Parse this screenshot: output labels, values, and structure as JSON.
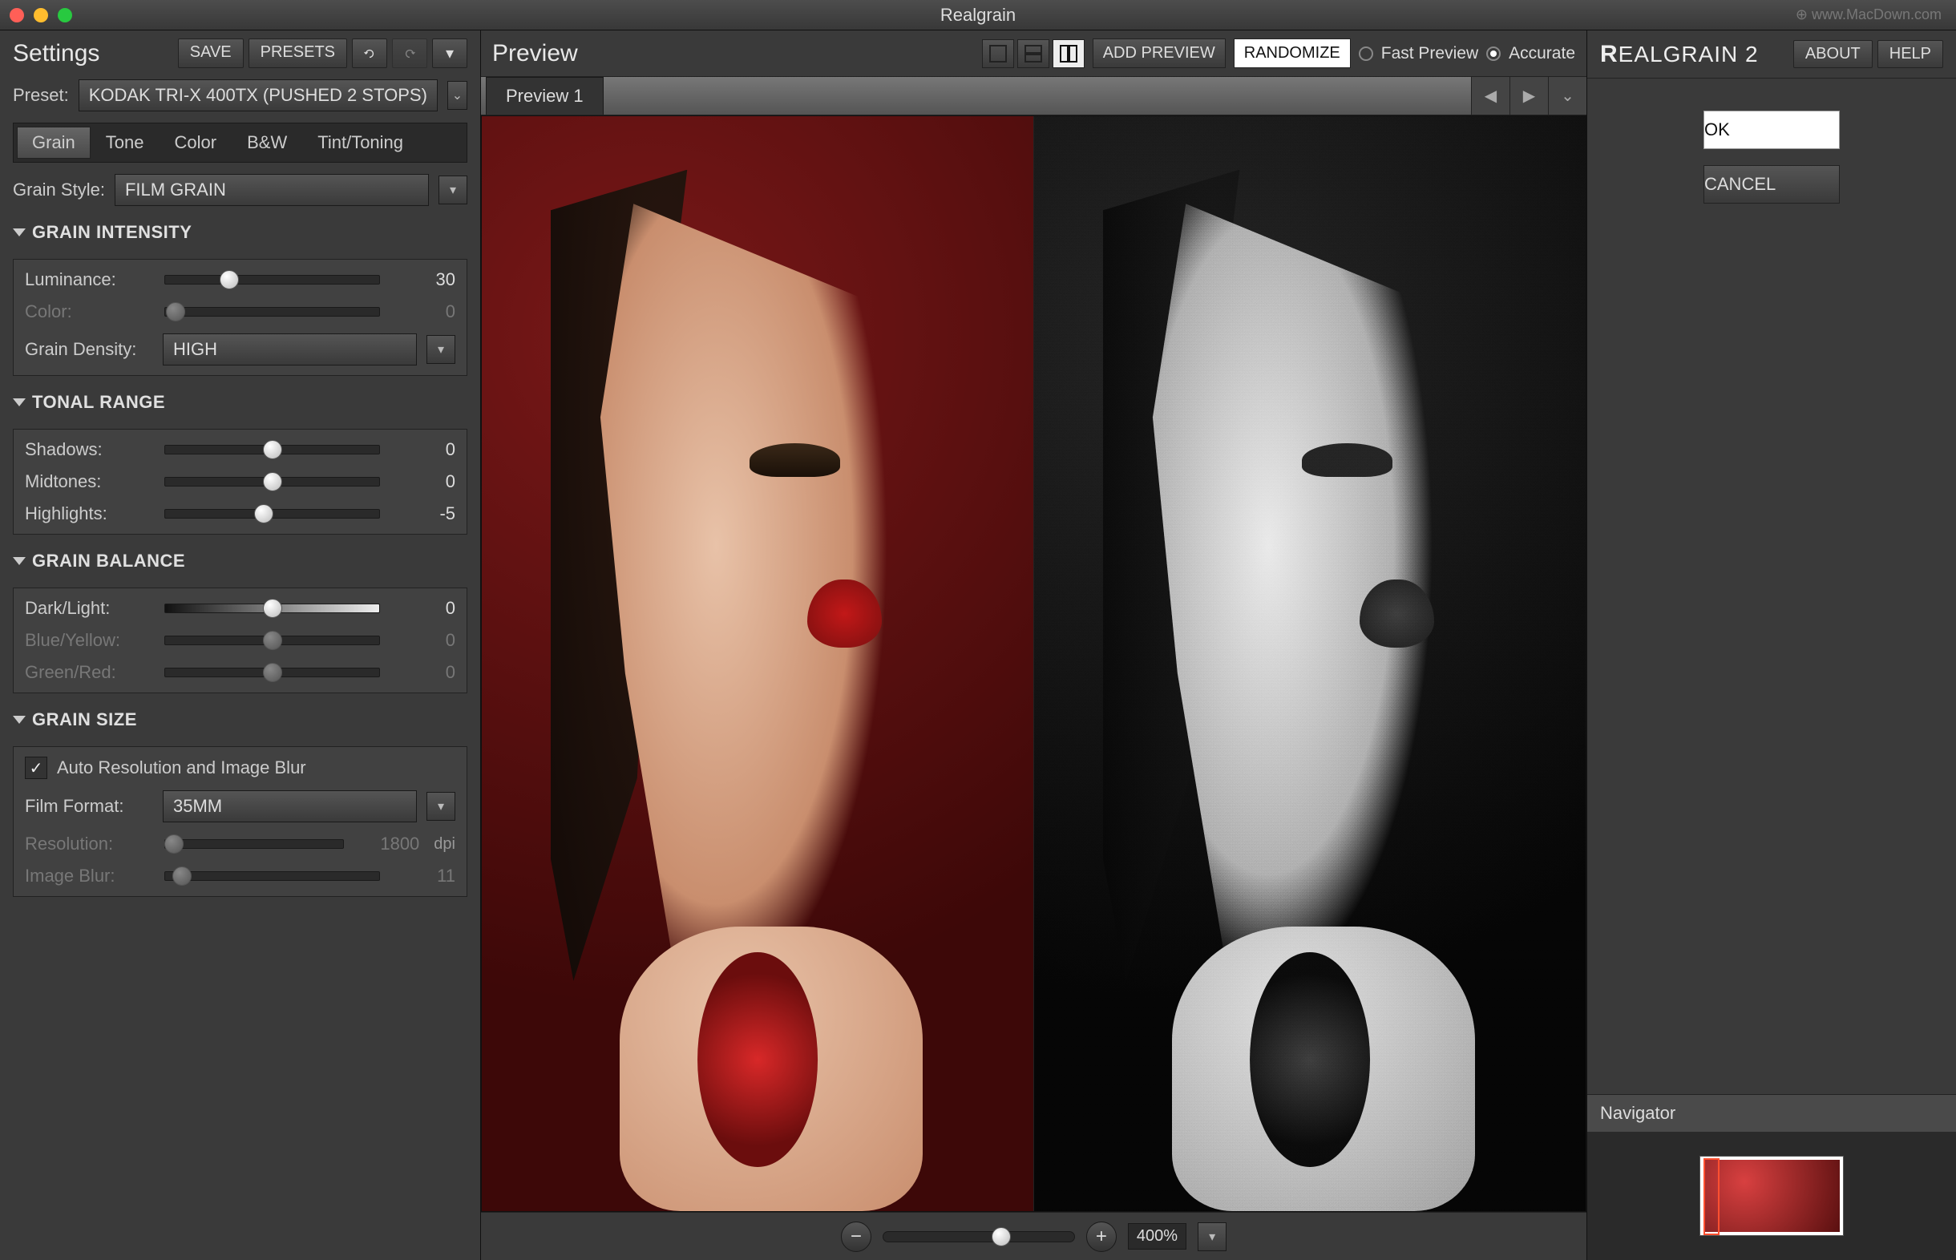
{
  "window": {
    "title": "Realgrain",
    "watermark": "⊕ www.MacDown.com"
  },
  "left": {
    "title": "Settings",
    "save": "SAVE",
    "presets": "PRESETS",
    "preset_label": "Preset:",
    "preset_value": "KODAK TRI-X 400TX (PUSHED 2 STOPS)",
    "tabs": [
      "Grain",
      "Tone",
      "Color",
      "B&W",
      "Tint/Toning"
    ],
    "grain_style_label": "Grain Style:",
    "grain_style_value": "FILM GRAIN",
    "sec_intensity": "GRAIN INTENSITY",
    "luminance_label": "Luminance:",
    "luminance_val": "30",
    "color_label": "Color:",
    "color_val": "0",
    "density_label": "Grain Density:",
    "density_value": "HIGH",
    "sec_tonal": "TONAL RANGE",
    "shadows_label": "Shadows:",
    "shadows_val": "0",
    "midtones_label": "Midtones:",
    "midtones_val": "0",
    "highlights_label": "Highlights:",
    "highlights_val": "-5",
    "sec_balance": "GRAIN BALANCE",
    "darklight_label": "Dark/Light:",
    "darklight_val": "0",
    "blueyellow_label": "Blue/Yellow:",
    "blueyellow_val": "0",
    "greenred_label": "Green/Red:",
    "greenred_val": "0",
    "sec_size": "GRAIN SIZE",
    "auto_label": "Auto Resolution and Image Blur",
    "film_format_label": "Film Format:",
    "film_format_value": "35MM",
    "resolution_label": "Resolution:",
    "resolution_val": "1800",
    "resolution_unit": "dpi",
    "blur_label": "Image Blur:",
    "blur_val": "11"
  },
  "center": {
    "title": "Preview",
    "add_preview": "ADD PREVIEW",
    "randomize": "RANDOMIZE",
    "fast": "Fast Preview",
    "accurate": "Accurate",
    "tab": "Preview 1",
    "zoom_val": "400%"
  },
  "right": {
    "logo_1": "R",
    "logo_2": "EALGRAIN",
    "logo_ver": " 2",
    "about": "ABOUT",
    "help": "HELP",
    "ok": "OK",
    "cancel": "CANCEL",
    "nav_title": "Navigator"
  }
}
